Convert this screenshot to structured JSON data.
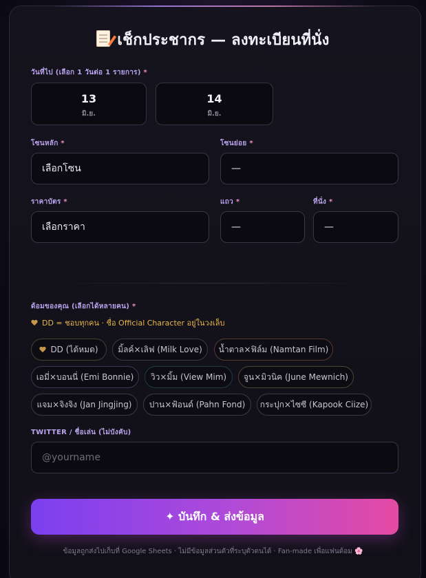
{
  "title": "เช็กประชากร — ลงทะเบียนที่นั่ง",
  "date_section": {
    "label": "วันที่ไป (เลือก 1 วันต่อ 1 รายการ)",
    "required_mark": "*",
    "dates": [
      {
        "day": "13",
        "month": "มิ.ย."
      },
      {
        "day": "14",
        "month": "มิ.ย."
      }
    ]
  },
  "zone": {
    "main_label": "โซนหลัก",
    "main_value": "เลือกโซน",
    "sub_label": "โซนย่อย",
    "sub_value": "—",
    "required_mark": "*"
  },
  "ticket": {
    "price_label": "ราคาบัตร",
    "price_value": "เลือกราคา",
    "row_label": "แถว",
    "row_value": "—",
    "seat_label": "ที่นั่ง",
    "seat_value": "—",
    "required_mark": "*"
  },
  "ships": {
    "label": "ด้อมของคุณ (เลือกได้หลายคน)",
    "required_mark": "*",
    "hint": "DD = ชอบทุกคน · ชื่อ Official Character อยู่ในวงเล็บ",
    "items": [
      {
        "label": "DD (ได้หมด)"
      },
      {
        "label": "มิ้ลค์×เลิฟ (Milk Love)"
      },
      {
        "label": "น้ำตาล×ฟิล์ม (Namtan Film)"
      },
      {
        "label": "เอมี่×บอนนี่ (Emi Bonnie)"
      },
      {
        "label": "วิว×มิ้ม (View Mim)"
      },
      {
        "label": "จูน×มิวนิค (June Mewnich)"
      },
      {
        "label": "แจม×จิงจิง (Jan Jingjing)"
      },
      {
        "label": "ปาน×ฟ้อนด์ (Pahn Fond)"
      },
      {
        "label": "กระปุก×ไซซี (Kapook Ciize)"
      }
    ]
  },
  "twitter": {
    "label": "TWITTER / ชื่อเล่น (ไม่บังคับ)",
    "placeholder": "@yourname"
  },
  "submit_label": "✦ บันทึก & ส่งข้อมูล",
  "footer": "ข้อมูลถูกส่งไปเก็บที่ Google Sheets · ไม่มีข้อมูลส่วนตัวที่ระบุตัวตนได้ · Fan-made เพื่อแฟนด้อม 🌸",
  "icons": {
    "title_icon": "memo-icon",
    "hint_icon": "heart-icon",
    "dd_icon": "heart-icon"
  },
  "colors": {
    "accent_label": "#b9a4ee",
    "required": "#f08fc4",
    "hint": "#e8b64a",
    "submit_start": "#7b3ff0",
    "submit_end": "#e54aa2"
  }
}
